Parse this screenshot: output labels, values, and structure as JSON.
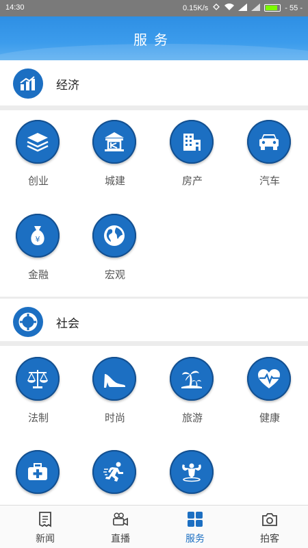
{
  "status_bar": {
    "time": "14:30",
    "speed": "0.15K/s",
    "battery_level": "55"
  },
  "header": {
    "title": "服务"
  },
  "sections": [
    {
      "title": "经济",
      "icon": "bar-chart-icon",
      "items": [
        {
          "label": "创业",
          "icon": "layers-icon"
        },
        {
          "label": "城建",
          "icon": "building-frame-icon"
        },
        {
          "label": "房产",
          "icon": "apartment-icon"
        },
        {
          "label": "汽车",
          "icon": "car-icon"
        },
        {
          "label": "金融",
          "icon": "money-bag-icon"
        },
        {
          "label": "宏观",
          "icon": "globe-icon"
        }
      ]
    },
    {
      "title": "社会",
      "icon": "lifebuoy-icon",
      "items": [
        {
          "label": "法制",
          "icon": "scales-icon"
        },
        {
          "label": "时尚",
          "icon": "high-heel-icon"
        },
        {
          "label": "旅游",
          "icon": "palm-tree-icon"
        },
        {
          "label": "健康",
          "icon": "heart-pulse-icon"
        },
        {
          "label": "",
          "icon": "first-aid-kit-icon"
        },
        {
          "label": "",
          "icon": "runner-icon"
        },
        {
          "label": "",
          "icon": "bodybuilder-icon"
        }
      ]
    }
  ],
  "tabbar": [
    {
      "label": "新闻",
      "icon": "news-icon"
    },
    {
      "label": "直播",
      "icon": "video-camera-icon"
    },
    {
      "label": "服务",
      "icon": "grid-icon",
      "active": true
    },
    {
      "label": "拍客",
      "icon": "camera-icon"
    }
  ],
  "colors": {
    "primary": "#1c6fc2",
    "header": "#3c9cec",
    "divider": "#ececec"
  }
}
